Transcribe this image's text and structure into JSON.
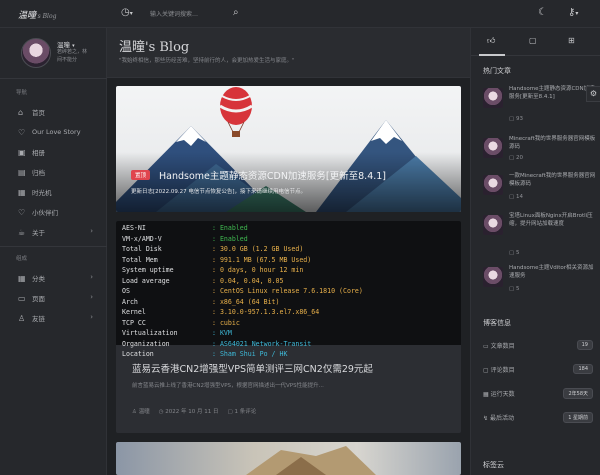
{
  "topbar": {
    "logo": "温曈",
    "logo_sub": "'s Blog",
    "search_placeholder": "输入关键词搜索…",
    "clock_icon": "clock-icon",
    "search_icon": "search-icon",
    "moon_icon": "moon-icon",
    "key_icon": "key-icon"
  },
  "profile": {
    "name": "温曈",
    "bio_line1": "若碎若之，林",
    "bio_line2": "间不能分"
  },
  "nav": {
    "section1": "导航",
    "items": [
      {
        "label": "首页",
        "icon": "home-icon"
      },
      {
        "label": "Our Love Story",
        "icon": "heart-icon"
      },
      {
        "label": "相册",
        "icon": "image-icon"
      },
      {
        "label": "归档",
        "icon": "archive-icon"
      },
      {
        "label": "时光机",
        "icon": "clock-icon"
      },
      {
        "label": "小伙伴们",
        "icon": "heart-icon"
      },
      {
        "label": "关于",
        "icon": "mug-icon"
      }
    ],
    "section2": "组成",
    "items2": [
      {
        "label": "分类",
        "icon": "grid-icon"
      },
      {
        "label": "页面",
        "icon": "folder-icon"
      },
      {
        "label": "友链",
        "icon": "user-icon"
      }
    ]
  },
  "header": {
    "title": "温曈's Blog",
    "subtitle": "\"我始终相信，那些历经苦难，坚持前行的人，会更加热爱生活与家庭。\""
  },
  "post1": {
    "badge": "置顶",
    "title": "Handsome主题静态资源CDN加速服务[更新至8.4.1]",
    "meta": "更新日志[2022.09.27 电信节点恢复公告]，接下来请继续用电信节点。"
  },
  "post2": {
    "terminal": [
      {
        "k": "AES-NI",
        "v": ": Enabled",
        "c": "green"
      },
      {
        "k": "VM-x/AMD-V",
        "v": ": Enabled",
        "c": "green"
      },
      {
        "k": "Total Disk",
        "v": ": 30.0 GB (1.2 GB Used)",
        "c": "yellow"
      },
      {
        "k": "Total Mem",
        "v": ": 991.1 MB (67.5 MB Used)",
        "c": "yellow"
      },
      {
        "k": "System uptime",
        "v": ": 0 days, 0 hour 12 min",
        "c": "yellow"
      },
      {
        "k": "Load average",
        "v": ": 0.04, 0.04, 0.05",
        "c": "yellow"
      },
      {
        "k": "OS",
        "v": ": CentOS Linux release 7.6.1810 (Core)",
        "c": "yellow"
      },
      {
        "k": "Arch",
        "v": ": x86_64 (64 Bit)",
        "c": "yellow"
      },
      {
        "k": "Kernel",
        "v": ": 3.10.0-957.1.3.el7.x86_64",
        "c": "yellow"
      },
      {
        "k": "TCP CC",
        "v": ": cubic",
        "c": "yellow"
      },
      {
        "k": "Virtualization",
        "v": ": KVM",
        "c": "cyan"
      },
      {
        "k": "Organization",
        "v": ": AS64021 Network-Transit",
        "c": "cyan"
      },
      {
        "k": "Location",
        "v": ": Sham Shui Po / HK",
        "c": "cyan"
      }
    ],
    "title": "蓝易云香港CN2增强型VPS简单测评三网CN2仅需29元起",
    "excerpt": "前言蓝易云推上线了香港CN2增强型VPS，根据官网描述出一代VPS性能提升...",
    "author": "温曈",
    "date": "2022 年 10 月 11 日",
    "comments": "1 条评论"
  },
  "right": {
    "hot_title": "热门文章",
    "hot": [
      {
        "title": "Handsome主题静态资源CDN加速服务[更新至8.4.1]",
        "count": "93"
      },
      {
        "title": "Minecraft我的世界服务器官网模板源码",
        "count": "20"
      },
      {
        "title": "一款Minecraft我的世界服务器官网模板源码",
        "count": "14"
      },
      {
        "title": "宝塔Linux面板Nginx开启Brotli压缩，提升网站加载速度",
        "count": "5"
      },
      {
        "title": "Handsome主题Vditor相关资源加速服务",
        "count": "5"
      }
    ],
    "info_title": "博客信息",
    "stats": [
      {
        "label": "文章数目",
        "value": "19",
        "icon": "doc-icon"
      },
      {
        "label": "评论数目",
        "value": "184",
        "icon": "comment-icon"
      },
      {
        "label": "运行天数",
        "value": "2年58天",
        "icon": "calendar-icon"
      },
      {
        "label": "最后活动",
        "value": "1 星期前",
        "icon": "pulse-icon"
      }
    ],
    "tag_title": "标签云"
  }
}
